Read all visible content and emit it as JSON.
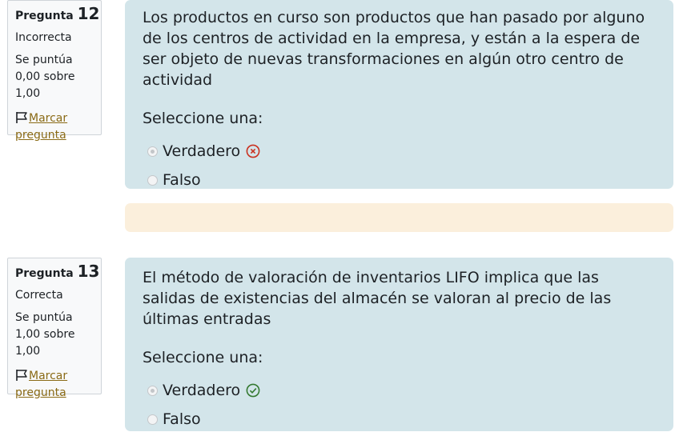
{
  "questions": [
    {
      "label": "Pregunta",
      "number": "12",
      "state": "Incorrecta",
      "grade": "Se puntúa 0,00 sobre 1,00",
      "flag": "Marcar pregunta",
      "text": "Los productos en curso son productos que han pasado por alguno de los centros de actividad en la empresa, y están a la espera de ser objeto de nuevas transformaciones en algún otro centro de actividad",
      "prompt": "Seleccione una:",
      "options": [
        {
          "label": "Verdadero",
          "selected": true,
          "mark": "incorrect-icon"
        },
        {
          "label": "Falso",
          "selected": false
        }
      ]
    },
    {
      "label": "Pregunta",
      "number": "13",
      "state": "Correcta",
      "grade": "Se puntúa 1,00 sobre 1,00",
      "flag": "Marcar pregunta",
      "text": "El método de valoración de inventarios LIFO implica que las salidas de existencias del almacén se valoran al precio de las últimas entradas",
      "prompt": "Seleccione una:",
      "options": [
        {
          "label": "Verdadero",
          "selected": true,
          "mark": "correct-icon"
        },
        {
          "label": "Falso",
          "selected": false
        }
      ]
    }
  ],
  "colors": {
    "content_bg": "#d3e5ea",
    "feedback_bg": "#fbefdc",
    "incorrect": "#ca3120",
    "correct": "#357a32",
    "link": "#8a6a15"
  }
}
